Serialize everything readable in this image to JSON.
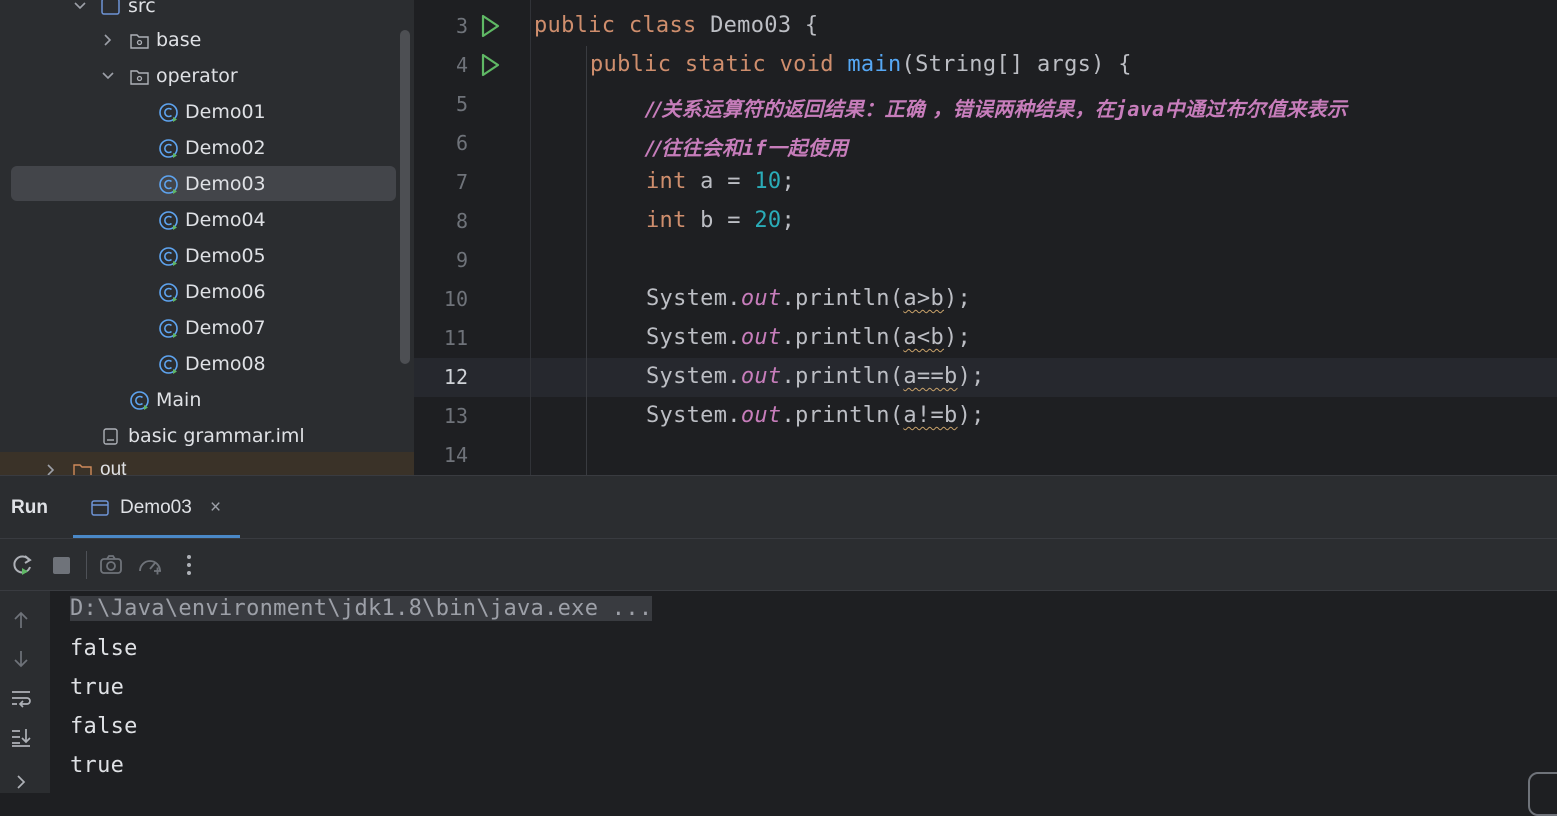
{
  "project_tree": {
    "items": [
      {
        "label": "src",
        "type": "folder",
        "state": "expanded"
      },
      {
        "label": "base",
        "type": "package",
        "state": "collapsed"
      },
      {
        "label": "operator",
        "type": "package",
        "state": "expanded"
      },
      {
        "label": "Demo01",
        "type": "class"
      },
      {
        "label": "Demo02",
        "type": "class"
      },
      {
        "label": "Demo03",
        "type": "class",
        "selected": true
      },
      {
        "label": "Demo04",
        "type": "class"
      },
      {
        "label": "Demo05",
        "type": "class"
      },
      {
        "label": "Demo06",
        "type": "class"
      },
      {
        "label": "Demo07",
        "type": "class"
      },
      {
        "label": "Demo08",
        "type": "class"
      },
      {
        "label": "Main",
        "type": "class"
      },
      {
        "label": "basic grammar.iml",
        "type": "file"
      },
      {
        "label": "out",
        "type": "folder",
        "state": "collapsed"
      }
    ]
  },
  "editor": {
    "current_line": 12,
    "lines": [
      {
        "num": "3"
      },
      {
        "num": "4"
      },
      {
        "num": "5"
      },
      {
        "num": "6"
      },
      {
        "num": "7"
      },
      {
        "num": "8"
      },
      {
        "num": "9"
      },
      {
        "num": "10"
      },
      {
        "num": "11"
      },
      {
        "num": "12"
      },
      {
        "num": "13"
      },
      {
        "num": "14"
      }
    ],
    "tokens": {
      "l3_kw": "public class ",
      "l3_name": "Demo03 {",
      "l4_kw": "public static void ",
      "l4_fn": "main",
      "l4_rest": "(String[] args) {",
      "l5_a": "//关系运算符的返回结果：正确 ，错误两种结果，在",
      "l5_b": "java",
      "l5_c": "中通过布尔值来表示",
      "l6_a": "//往往会和",
      "l6_b": "if",
      "l6_c": "一起使用",
      "l7_kw": "int",
      "l7_mid": " a = ",
      "l7_num": "10",
      "l7_end": ";",
      "l8_kw": "int",
      "l8_mid": " b = ",
      "l8_num": "20",
      "l8_end": ";",
      "sys": "System.",
      "out": "out",
      "println": ".println(",
      "l10_arg": "a>b",
      "l11_arg": "a<b",
      "l12_arg": "a==b",
      "l13_arg": "a!=b",
      "close": ");"
    }
  },
  "run_panel": {
    "title": "Run",
    "tab_label": "Demo03",
    "tab_close": "×",
    "command": "D:\\Java\\environment\\jdk1.8\\bin\\java.exe ...",
    "output": [
      "false",
      "true",
      "false",
      "true"
    ],
    "toolbar": [
      "rerun-icon",
      "stop-icon",
      "screenshot-icon",
      "profiler-icon",
      "more-icon"
    ]
  },
  "colors": {
    "keyword": "#cf8e6d",
    "function": "#56a8f5",
    "number": "#2aacb8",
    "static_field": "#c77dbb",
    "comment": "#c77dbb",
    "run_green": "#5fb865",
    "class_icon": "#5ea4f0"
  }
}
